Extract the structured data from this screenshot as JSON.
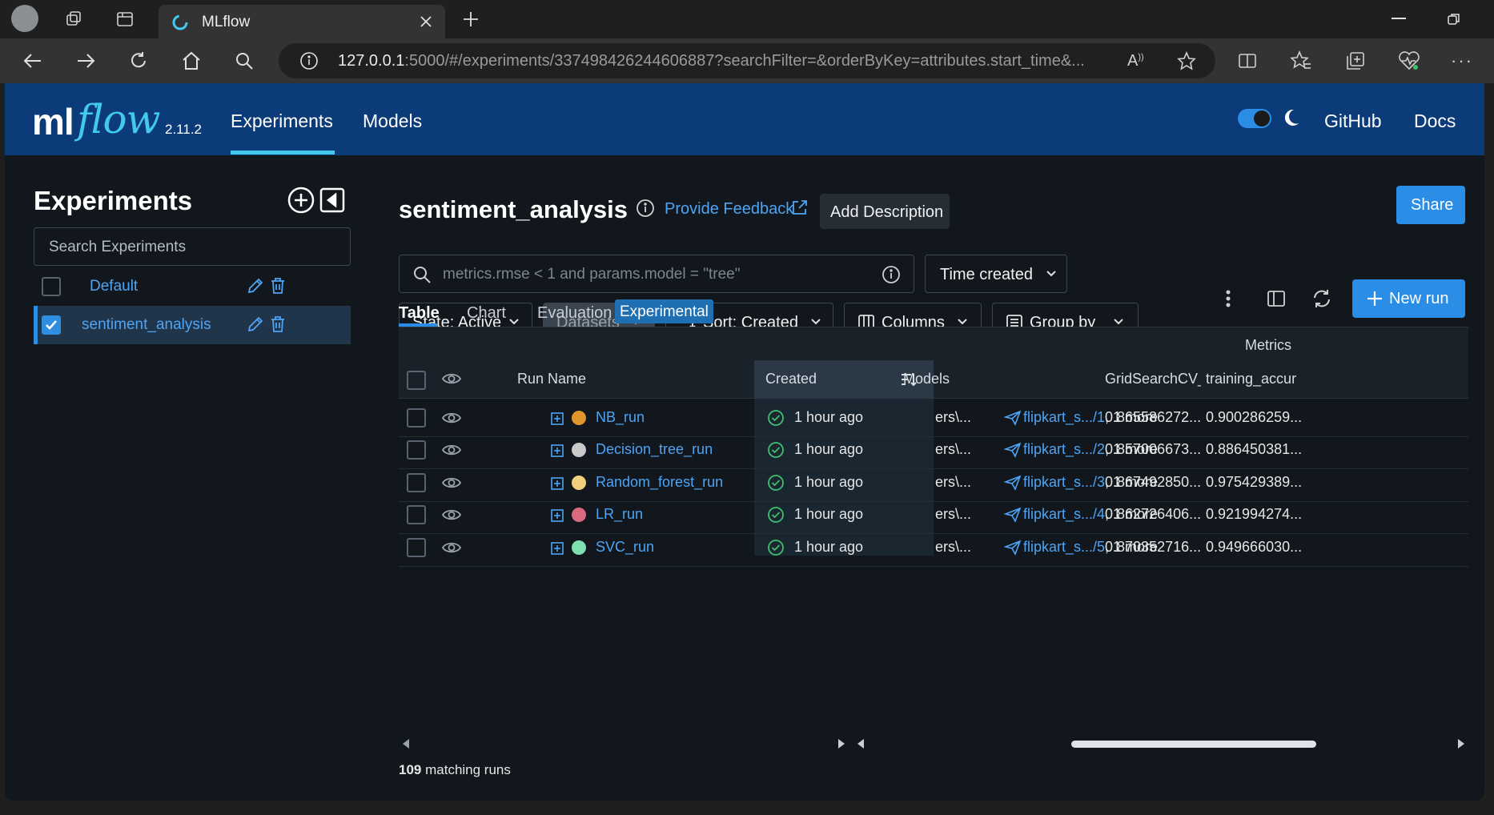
{
  "browser": {
    "tab_title": "MLflow",
    "url_host": "127.0.0.1",
    "url_rest": ":5000/#/experiments/337498426244606887?searchFilter=&orderByKey=attributes.start_time&..."
  },
  "header": {
    "logo_ml": "ml",
    "logo_flow": "flow",
    "version": "2.11.2",
    "nav": [
      "Experiments",
      "Models"
    ],
    "github": "GitHub",
    "docs": "Docs"
  },
  "sidebar": {
    "title": "Experiments",
    "search_placeholder": "Search Experiments",
    "experiments": [
      {
        "name": "Default",
        "checked": false
      },
      {
        "name": "sentiment_analysis",
        "checked": true
      }
    ]
  },
  "main": {
    "title": "sentiment_analysis",
    "provide_feedback": "Provide Feedback",
    "add_description": "Add Description",
    "share": "Share",
    "search_placeholder": "metrics.rmse < 1 and params.model = \"tree\"",
    "time_created": "Time created",
    "state": "State: Active",
    "datasets": "Datasets",
    "sort": "Sort: Created",
    "columns": "Columns",
    "group_by": "Group by",
    "new_run": "New run",
    "tabs": [
      "Table",
      "Chart",
      "Evaluation"
    ],
    "experimental_badge": "Experimental",
    "matching_count": "109",
    "matching_label": "matching runs"
  },
  "table": {
    "group_header": "Metrics",
    "columns": [
      "Run Name",
      "Created",
      "Models",
      "GridSearchCV_sc",
      "training_accurac"
    ],
    "rows": [
      {
        "name": "NB_run",
        "color": "#e0952d",
        "created": "1 hour ago",
        "truncated": "ers\\...",
        "model": "flipkart_s.../1",
        "more": ", 1 more",
        "m1": "0.865586272...",
        "m2": "0.900286259..."
      },
      {
        "name": "Decision_tree_run",
        "color": "#c9c9c9",
        "created": "1 hour ago",
        "truncated": "ers\\...",
        "model": "flipkart_s.../2",
        "more": ", 1 more",
        "m1": "0.857006673...",
        "m2": "0.886450381..."
      },
      {
        "name": "Random_forest_run",
        "color": "#f2cf7e",
        "created": "1 hour ago",
        "truncated": "ers\\...",
        "model": "flipkart_s.../3",
        "more": ", 1 more",
        "m1": "0.867492850...",
        "m2": "0.975429389..."
      },
      {
        "name": "LR_run",
        "color": "#d96a80",
        "created": "1 hour ago",
        "truncated": "ers\\...",
        "model": "flipkart_s.../4",
        "more": ", 1 more",
        "m1": "0.862726406...",
        "m2": "0.921994274..."
      },
      {
        "name": "SVC_run",
        "color": "#7ee0b0",
        "created": "1 hour ago",
        "truncated": "ers\\...",
        "model": "flipkart_s.../5",
        "more": ", 1 more",
        "m1": "0.870352716...",
        "m2": "0.949666030..."
      }
    ]
  }
}
